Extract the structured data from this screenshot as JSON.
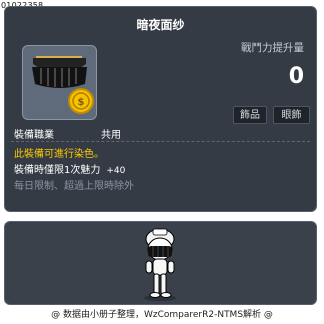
{
  "item": {
    "id": "01022358",
    "name": "暗夜面纱",
    "power_label": "戰鬥力提升量",
    "power_value": "0",
    "tags": [
      "飾品",
      "眼飾"
    ],
    "job_label": "裝備職業",
    "job_value": "共用"
  },
  "description": {
    "dye_note": "此裝備可進行染色。",
    "stat_label": "裝備時僅限1次魅力",
    "stat_value": "+40",
    "limit_note": "每日限制、超過上限時除外"
  },
  "footer": {
    "credit": "@ 数据由小册子整理，WzComparerR2-NTMS解析 @"
  },
  "icons": [
    "item-icon",
    "character-preview"
  ]
}
